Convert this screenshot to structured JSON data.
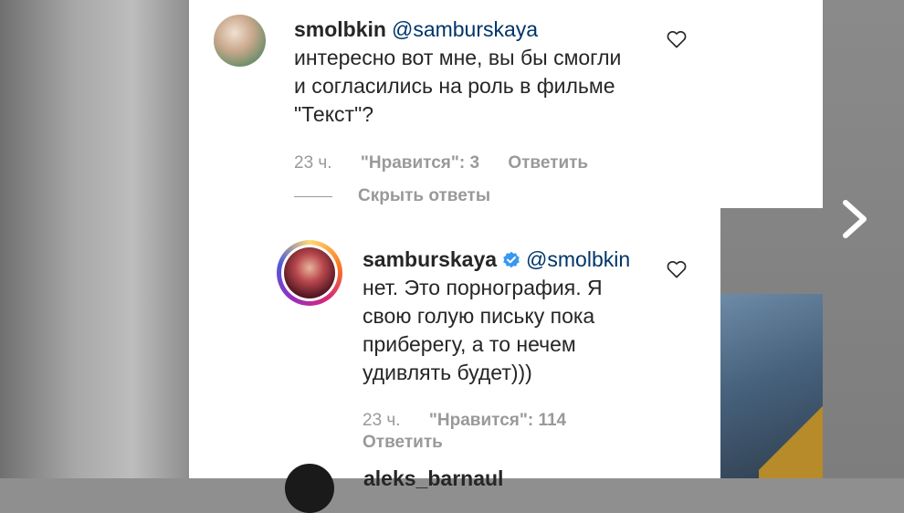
{
  "comments": [
    {
      "username": "smolbkin",
      "mention": "@samburskaya",
      "text_lines": [
        "интересно вот мне, вы бы смогли",
        "и согласились на роль в фильме",
        "\"Текст\"?"
      ],
      "time": "23 ч.",
      "likes": "\"Нравится\": 3",
      "reply_label": "Ответить",
      "hide_replies_label": "Скрыть ответы"
    },
    {
      "username": "samburskaya",
      "verified": true,
      "mention": "@smolbkin",
      "text_lines": [
        "нет. Это порнография. Я",
        "свою голую письку пока",
        "приберегу, а то нечем",
        "удивлять будет)))"
      ],
      "time": "23 ч.",
      "likes": "\"Нравится\": 114",
      "reply_label": "Ответить"
    },
    {
      "username": "aleks_barnaul"
    }
  ],
  "icons": {
    "like": "heart-icon",
    "verified": "verified-badge-icon",
    "next": "chevron-right-icon"
  },
  "colors": {
    "text": "#262626",
    "mention": "#003569",
    "meta": "#999999",
    "verified": "#3897f0"
  }
}
